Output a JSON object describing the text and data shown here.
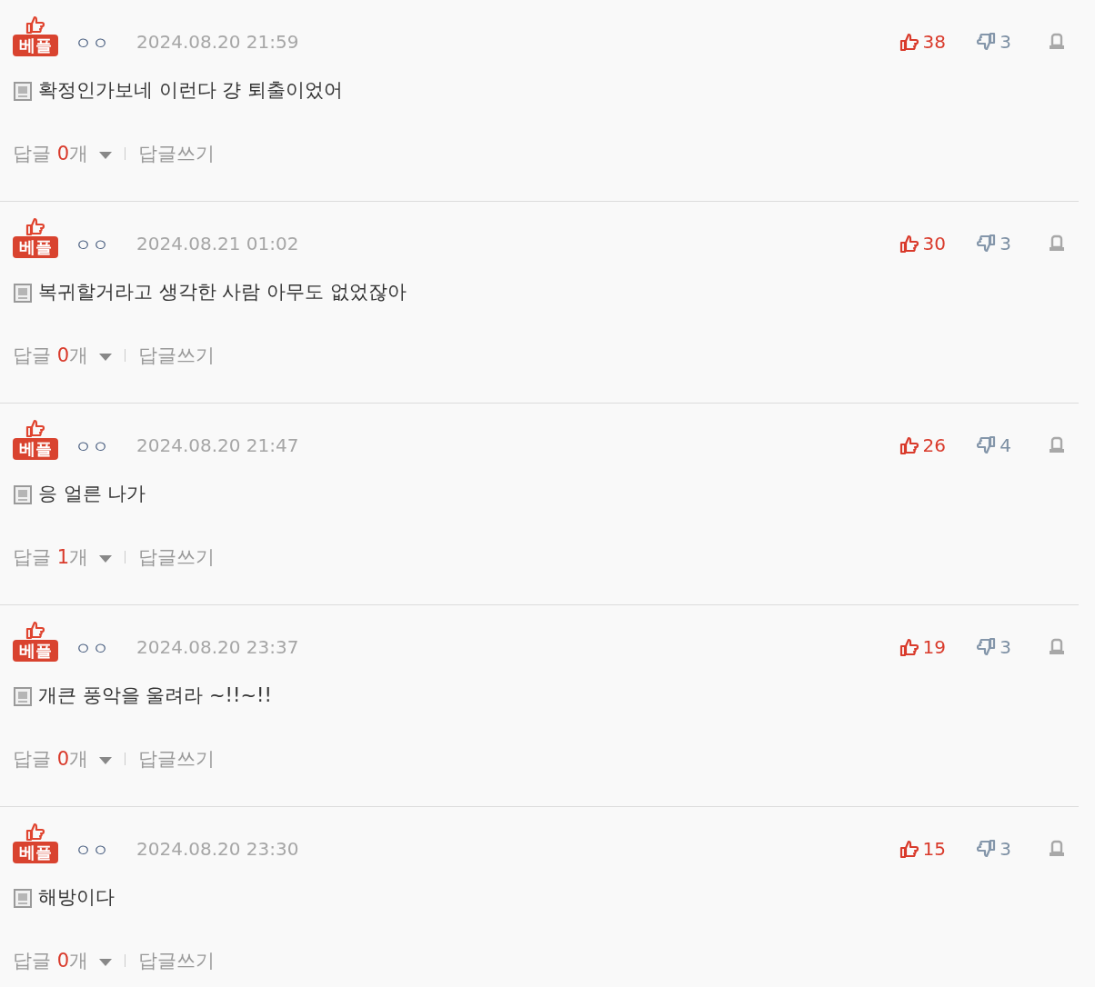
{
  "comments": [
    {
      "badge": "베플",
      "user": "ㅇㅇ",
      "date": "2024.08.20 21:59",
      "text": "확정인가보네 이런다 걍 퇴출이었어",
      "likes": "38",
      "dislikes": "3",
      "reply_label": "답글",
      "reply_count": "0",
      "reply_unit": "개",
      "write_reply": "답글쓰기"
    },
    {
      "badge": "베플",
      "user": "ㅇㅇ",
      "date": "2024.08.21 01:02",
      "text": "복귀할거라고 생각한 사람 아무도 없었잖아",
      "likes": "30",
      "dislikes": "3",
      "reply_label": "답글",
      "reply_count": "0",
      "reply_unit": "개",
      "write_reply": "답글쓰기"
    },
    {
      "badge": "베플",
      "user": "ㅇㅇ",
      "date": "2024.08.20 21:47",
      "text": "응 얼른 나가",
      "likes": "26",
      "dislikes": "4",
      "reply_label": "답글",
      "reply_count": "1",
      "reply_unit": "개",
      "write_reply": "답글쓰기"
    },
    {
      "badge": "베플",
      "user": "ㅇㅇ",
      "date": "2024.08.20 23:37",
      "text": "개큰 풍악을 울려라 ~!!~!!",
      "likes": "19",
      "dislikes": "3",
      "reply_label": "답글",
      "reply_count": "0",
      "reply_unit": "개",
      "write_reply": "답글쓰기"
    },
    {
      "badge": "베플",
      "user": "ㅇㅇ",
      "date": "2024.08.20 23:30",
      "text": "해방이다",
      "likes": "15",
      "dislikes": "3",
      "reply_label": "답글",
      "reply_count": "0",
      "reply_unit": "개",
      "write_reply": "답글쓰기"
    }
  ]
}
